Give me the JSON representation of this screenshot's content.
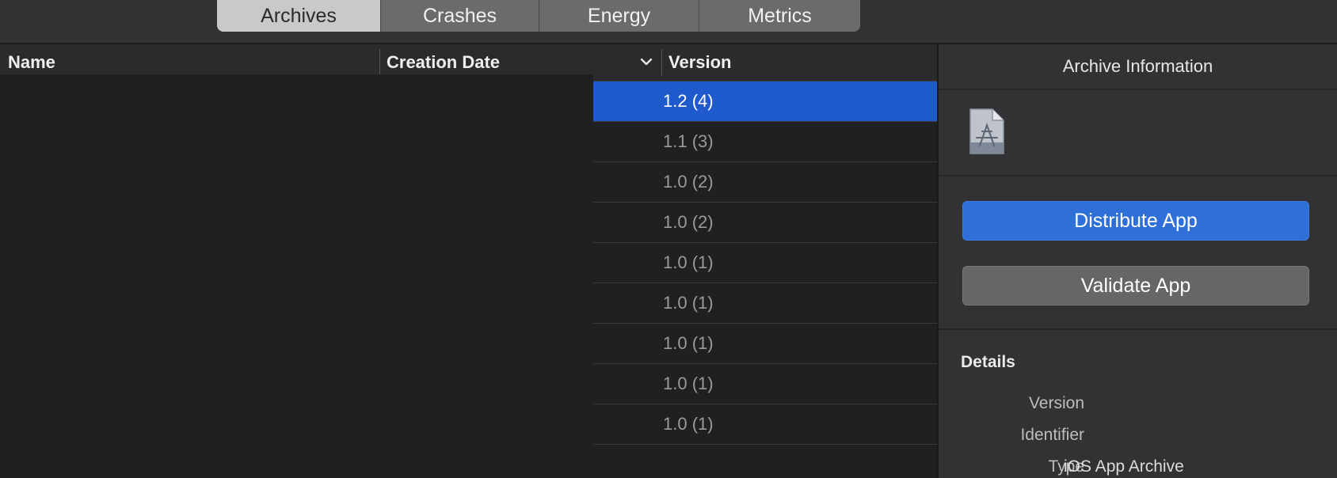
{
  "tabs": [
    {
      "label": "Archives"
    },
    {
      "label": "Crashes"
    },
    {
      "label": "Energy"
    },
    {
      "label": "Metrics"
    }
  ],
  "table": {
    "columns": {
      "name": "Name",
      "creation_date": "Creation Date",
      "version": "Version"
    },
    "sort_indicator": "chevron-down",
    "rows": [
      {
        "version": "1.2 (4)"
      },
      {
        "version": "1.1 (3)"
      },
      {
        "version": "1.0 (2)"
      },
      {
        "version": "1.0 (2)"
      },
      {
        "version": "1.0 (1)"
      },
      {
        "version": "1.0 (1)"
      },
      {
        "version": "1.0 (1)"
      },
      {
        "version": "1.0 (1)"
      },
      {
        "version": "1.0 (1)"
      }
    ]
  },
  "inspector": {
    "title": "Archive Information",
    "icon": "app-archive-icon",
    "distribute_label": "Distribute App",
    "validate_label": "Validate App",
    "details_title": "Details",
    "details": [
      {
        "label": "Version",
        "value": ""
      },
      {
        "label": "Identifier",
        "value": ""
      },
      {
        "label": "Type",
        "value": "iOS App Archive"
      }
    ]
  },
  "colors": {
    "selection": "#1f5acc",
    "primary_button": "#2f6fd8",
    "background": "#1f2022",
    "inspector_bg": "#323234"
  }
}
